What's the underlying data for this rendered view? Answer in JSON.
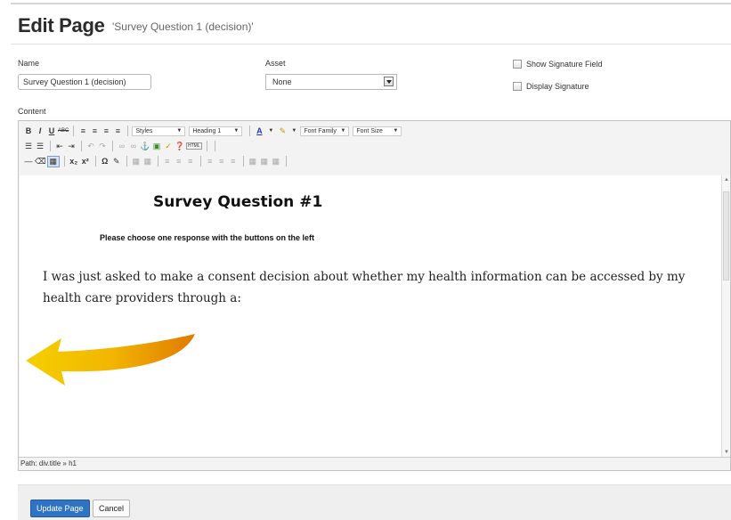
{
  "header": {
    "title": "Edit Page",
    "subtitle": "'Survey Question 1 (decision)'"
  },
  "form": {
    "name_label": "Name",
    "name_value": "Survey Question 1 (decision)",
    "asset_label": "Asset",
    "asset_value": "None",
    "show_signature_label": "Show Signature Field",
    "display_signature_label": "Display Signature",
    "content_label": "Content"
  },
  "toolbar": {
    "row1": {
      "bold": "B",
      "italic": "I",
      "underline": "U",
      "strike": "ABC",
      "styles_dropdown": "Styles",
      "format_dropdown": "Heading 1",
      "font_color": "A",
      "font_family_dropdown": "Font Family",
      "font_size_dropdown": "Font Size"
    },
    "row2": {
      "html_button": "HTML"
    },
    "row3": {
      "subscript": "x₂",
      "superscript": "x²",
      "omega": "Ω"
    }
  },
  "editor_content": {
    "heading": "Survey Question #1",
    "instruction": "Please choose one response with the buttons on the left",
    "paragraph": "I was just asked to make a consent decision about whether my health information can be accessed by my health care providers through a:"
  },
  "status_bar": {
    "path": "Path: div.title » h1"
  },
  "footer": {
    "update_button": "Update Page",
    "cancel_button": "Cancel"
  },
  "colors": {
    "primary_button": "#2f73c4",
    "arrow_gold": "#f2b600",
    "arrow_orange": "#e07a00"
  },
  "icons": [
    "bulleted-list-icon",
    "numbered-list-icon",
    "outdent-icon",
    "indent-icon",
    "undo-icon",
    "redo-icon",
    "link-icon",
    "unlink-icon",
    "anchor-icon",
    "image-icon",
    "cleanup-icon",
    "help-icon",
    "horizontal-rule-icon",
    "remove-format-icon",
    "visual-aid-icon",
    "character-map-icon",
    "edit-image-icon",
    "table-icon",
    "scroll-up-icon",
    "scroll-down-icon",
    "arrow-left-graphic"
  ]
}
